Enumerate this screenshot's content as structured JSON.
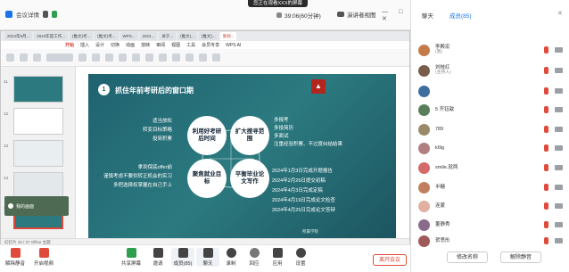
{
  "topbar": {
    "meeting_info_label": "会议详情",
    "toast": "您正在观看XXX的屏幕",
    "timer": "39:06(60分钟)",
    "view_label": "演讲者视图",
    "window_controls": "— □ ✕"
  },
  "wps": {
    "tabs": [
      "2024年5月...",
      "2024年度工作...",
      "(推文)考...",
      "(推文)考...",
      "WPS...",
      "2024...",
      "关于...",
      "(推文)...",
      "(推文)...",
      "策划..."
    ],
    "menu": [
      "开始",
      "插入",
      "设计",
      "切换",
      "动画",
      "放映",
      "审阅",
      "视图",
      "工具",
      "会员专享",
      "WPS AI"
    ],
    "active_menu": "开始",
    "thumb_numbers": [
      "11",
      "12",
      "13",
      "14",
      "15"
    ],
    "camera_tile_label": "我的画面",
    "status_text": "幻灯片 15 / 27    Office 主题"
  },
  "slide": {
    "number": "1",
    "title": "抓住年前考研后的窗口期",
    "left_top": [
      "适当放松",
      "转变目标策略",
      "投简积累"
    ],
    "left_bottom": [
      "拿到保底offer前",
      "谨慎考虑不要供转正机会的实习",
      "多把选择权掌握在自己手上"
    ],
    "circles": [
      "利用好考研后时间",
      "扩大搜寻范围",
      "聚焦就业目标",
      "平衡毕业论文写作"
    ],
    "right_top": [
      "多报考",
      "多投简历",
      "多面试",
      "注重经验积累、不过度纠结结果"
    ],
    "right_bottom": [
      "2024年1月3日完成开题报告",
      "2024年2月26日提交初稿",
      "2024年4月3日完成定稿",
      "2024年4月19日完成论文检查",
      "2024年4月25日完成论文答辩"
    ],
    "footer": "所属学院"
  },
  "bottombar": {
    "tools": [
      "解除静音",
      "开启视频",
      "共享屏幕",
      "邀请",
      "成员(85)",
      "聊天",
      "录制",
      "回应",
      "应用",
      "设置"
    ],
    "leave": "离开会议"
  },
  "panel": {
    "tabs": [
      "聊天",
      "成员(85)"
    ],
    "active_tab": "成员(85)",
    "members": [
      {
        "name": "李殿宏",
        "sub": "(我)",
        "color": "#c47b4a"
      },
      {
        "name": "刘枝红",
        "sub": "(主持人)",
        "color": "#7a5c4c"
      },
      {
        "name": "",
        "sub": "",
        "color": "#3d6e9e"
      },
      {
        "name": "5 齐钰歆",
        "sub": "",
        "color": "#5a7d5a"
      },
      {
        "name": "789",
        "sub": "",
        "color": "#9a8a6a"
      },
      {
        "name": "k6lg",
        "sub": "",
        "color": "#b08080"
      },
      {
        "name": "smile.就两",
        "sub": "",
        "color": "#d46a6a"
      },
      {
        "name": "半糖",
        "sub": "",
        "color": "#c08060"
      },
      {
        "name": "连蒙",
        "sub": "",
        "color": "#e2b0a0"
      },
      {
        "name": "董静秀",
        "sub": "",
        "color": "#8a6a8a"
      },
      {
        "name": "贺思彤",
        "sub": "",
        "color": "#a05a5a"
      }
    ],
    "rename_button": "修改名称",
    "unmute_button": "解除静音"
  }
}
